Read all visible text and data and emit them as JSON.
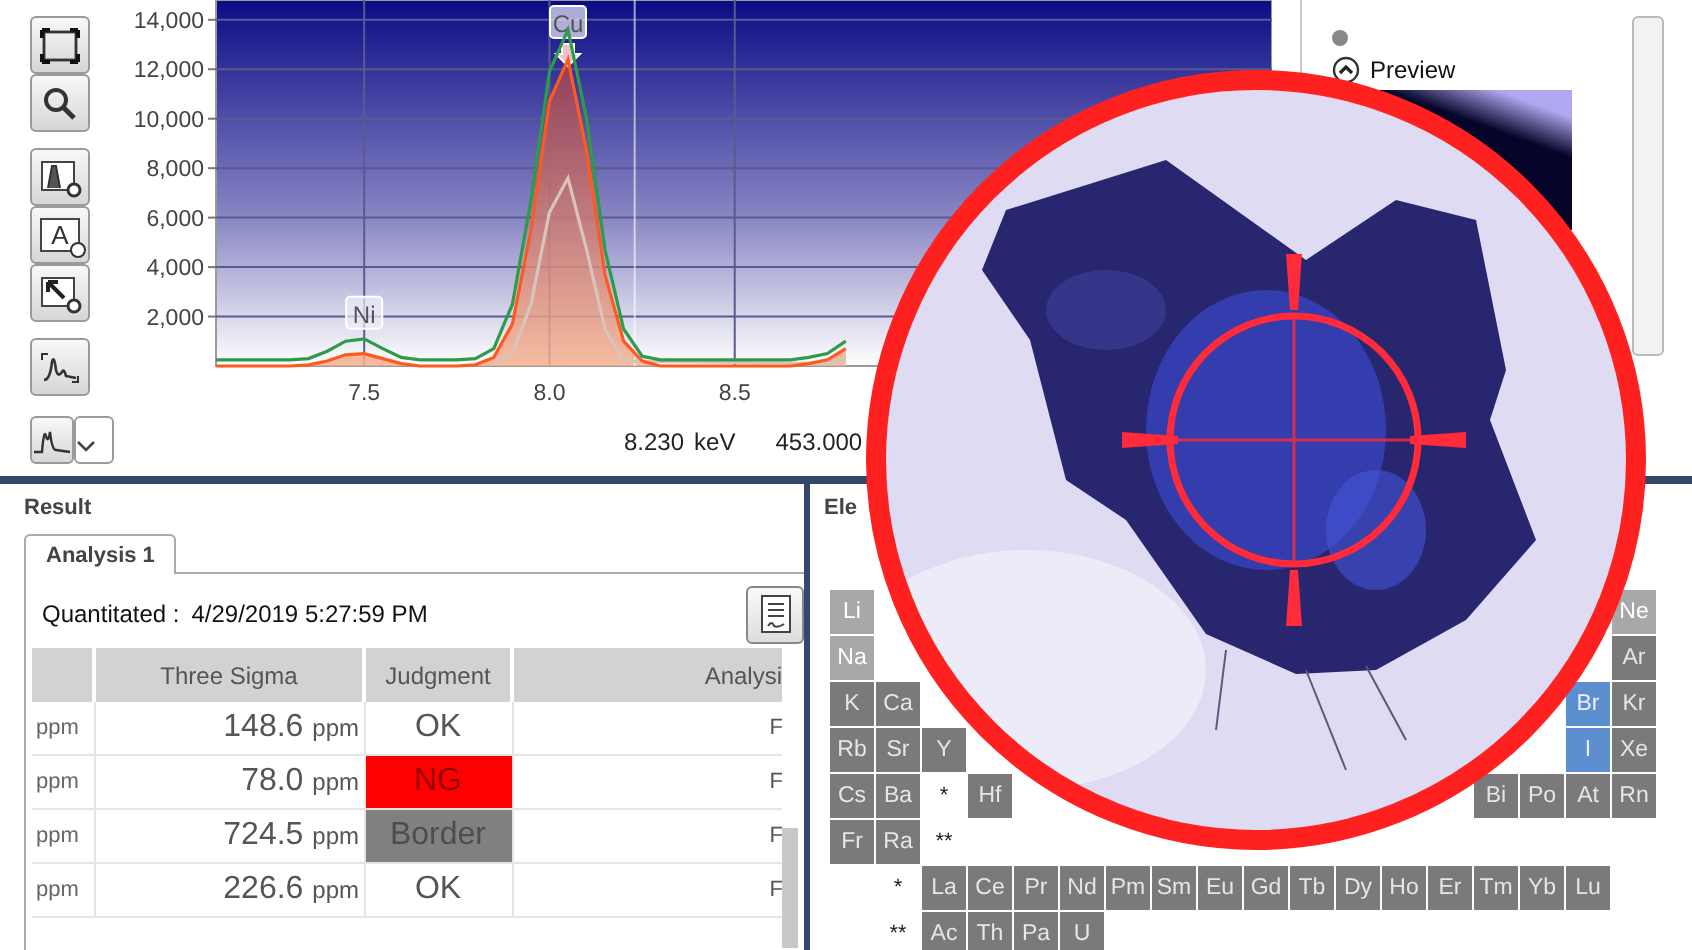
{
  "toolbar": [
    [
      {
        "kind": "fit"
      },
      {
        "kind": "zoom"
      }
    ],
    [
      {
        "kind": "peak"
      },
      {
        "kind": "label",
        "glyph": "A"
      },
      {
        "kind": "pointer"
      }
    ],
    [
      {
        "kind": "spectrum"
      }
    ]
  ],
  "spectrum": {
    "chart_data": {
      "type": "line",
      "xlim": [
        7.1,
        9.95
      ],
      "ylim": [
        0,
        14800
      ],
      "grid": true,
      "xticks": [
        {
          "value": 7.5,
          "label": "7.5"
        },
        {
          "value": 8.0,
          "label": "8.0"
        },
        {
          "value": 8.5,
          "label": "8.5"
        }
      ],
      "yticks": [
        {
          "value": 2000,
          "label": "2,000"
        },
        {
          "value": 4000,
          "label": "4,000"
        },
        {
          "value": 6000,
          "label": "6,000"
        },
        {
          "value": 8000,
          "label": "8,000"
        },
        {
          "value": 10000,
          "label": "10,000"
        },
        {
          "value": 12000,
          "label": "12,000"
        },
        {
          "value": 14000,
          "label": "14,000"
        }
      ],
      "x": [
        7.1,
        7.15,
        7.2,
        7.25,
        7.3,
        7.35,
        7.4,
        7.45,
        7.5,
        7.55,
        7.6,
        7.65,
        7.7,
        7.75,
        7.8,
        7.85,
        7.9,
        7.95,
        8.0,
        8.05,
        8.1,
        8.15,
        8.2,
        8.25,
        8.3,
        8.35,
        8.4,
        8.45,
        8.5,
        8.55,
        8.6,
        8.65,
        8.7,
        8.75,
        8.8
      ],
      "series": [
        {
          "color": "#2e9a4a",
          "values": [
            250,
            250,
            250,
            250,
            250,
            300,
            600,
            1000,
            1100,
            700,
            350,
            250,
            250,
            250,
            300,
            700,
            2500,
            6700,
            11900,
            13600,
            10000,
            4700,
            1500,
            400,
            250,
            250,
            250,
            250,
            250,
            250,
            250,
            250,
            350,
            500,
            1000
          ]
        },
        {
          "color": "#ff5a1e",
          "values": [
            0,
            0,
            0,
            0,
            0,
            50,
            200,
            450,
            500,
            300,
            100,
            0,
            0,
            0,
            50,
            350,
            1700,
            5500,
            10700,
            12400,
            8700,
            3700,
            1000,
            200,
            0,
            0,
            0,
            0,
            0,
            0,
            0,
            0,
            100,
            250,
            700
          ]
        },
        {
          "color": "#d8c4bc",
          "values": [
            null,
            null,
            null,
            null,
            null,
            null,
            null,
            null,
            null,
            null,
            null,
            null,
            null,
            null,
            null,
            100,
            500,
            2500,
            6200,
            7600,
            4700,
            1500,
            200,
            null,
            null,
            null,
            null,
            null,
            null,
            null,
            null,
            null,
            null,
            100,
            300
          ]
        }
      ],
      "annotations": [
        {
          "x": 7.5,
          "y": 1100,
          "text": "Ni"
        },
        {
          "x": 8.05,
          "y": 13600,
          "text": "Cu"
        }
      ],
      "ref_lines": [
        {
          "axis": "x",
          "value": 8.23
        }
      ]
    },
    "cursor": {
      "energy": "8.230",
      "unit": "keV",
      "count": "453.000"
    }
  },
  "preview": {
    "label": "Preview",
    "expanded": true
  },
  "result": {
    "title": "Result",
    "tabs": [
      {
        "label": "Analysis 1",
        "selected": true
      }
    ],
    "quantitated_label": "Quantitated :",
    "quantitated_time": "4/29/2019 5:27:59 PM",
    "table": {
      "columns": [
        "Three Sigma",
        "Judgment",
        "Analysi"
      ],
      "rows": [
        {
          "unit": "ppm",
          "three_sigma": "148.6",
          "sigma_unit": "ppm",
          "judgment": "OK",
          "color": "#ffffff",
          "analysis": "F"
        },
        {
          "unit": "ppm",
          "three_sigma": "78.0",
          "sigma_unit": "ppm",
          "judgment": "NG",
          "color": "#ff0000",
          "analysis": "F"
        },
        {
          "unit": "ppm",
          "three_sigma": "724.5",
          "sigma_unit": "ppm",
          "judgment": "Border",
          "color": "#808080",
          "analysis": "F"
        },
        {
          "unit": "ppm",
          "three_sigma": "226.6",
          "sigma_unit": "ppm",
          "judgment": "OK",
          "color": "#ffffff",
          "analysis": "F"
        }
      ]
    }
  },
  "elements": {
    "title": "Ele",
    "rows": [
      {
        "left": [
          {
            "kind": "element",
            "label": "Li",
            "selected": false,
            "disabled": true
          }
        ],
        "right": [
          {
            "kind": "element",
            "label": "Ne",
            "selected": false,
            "disabled": true
          }
        ]
      },
      {
        "left": [
          {
            "kind": "element",
            "label": "Na",
            "selected": false,
            "disabled": true
          }
        ],
        "right": [
          {
            "kind": "element",
            "label": "Ar",
            "selected": false,
            "disabled": false
          }
        ]
      },
      {
        "left": [
          {
            "kind": "element",
            "label": "K",
            "selected": false,
            "disabled": false
          },
          {
            "kind": "element",
            "label": "Ca",
            "selected": false,
            "disabled": false
          }
        ],
        "right": [
          {
            "kind": "element",
            "label": "Br",
            "selected": true,
            "disabled": false
          },
          {
            "kind": "element",
            "label": "Kr",
            "selected": false,
            "disabled": false
          }
        ]
      },
      {
        "left": [
          {
            "kind": "element",
            "label": "Rb",
            "selected": false,
            "disabled": false
          },
          {
            "kind": "element",
            "label": "Sr",
            "selected": false,
            "disabled": false
          },
          {
            "kind": "element",
            "label": "Y",
            "selected": false,
            "disabled": false
          }
        ],
        "right": [
          {
            "kind": "element",
            "label": "I",
            "selected": true,
            "disabled": false
          },
          {
            "kind": "element",
            "label": "Xe",
            "selected": false,
            "disabled": false
          }
        ]
      },
      {
        "left": [
          {
            "kind": "element",
            "label": "Cs",
            "selected": false,
            "disabled": false
          },
          {
            "kind": "element",
            "label": "Ba",
            "selected": false,
            "disabled": false
          },
          {
            "kind": "mark",
            "label": "*"
          },
          {
            "kind": "element",
            "label": "Hf",
            "selected": false,
            "disabled": false
          }
        ],
        "right": [
          {
            "kind": "element",
            "label": "Bi",
            "selected": false,
            "disabled": false
          },
          {
            "kind": "element",
            "label": "Po",
            "selected": false,
            "disabled": false
          },
          {
            "kind": "element",
            "label": "At",
            "selected": false,
            "disabled": false
          },
          {
            "kind": "element",
            "label": "Rn",
            "selected": false,
            "disabled": false
          }
        ]
      },
      {
        "left": [
          {
            "kind": "element",
            "label": "Fr",
            "selected": false,
            "disabled": false
          },
          {
            "kind": "element",
            "label": "Ra",
            "selected": false,
            "disabled": false
          },
          {
            "kind": "mark",
            "label": "**"
          }
        ],
        "right": []
      },
      {
        "left": [
          {
            "kind": "gap"
          },
          {
            "kind": "mark",
            "label": "*"
          },
          {
            "kind": "element",
            "label": "La",
            "selected": false,
            "disabled": false
          },
          {
            "kind": "element",
            "label": "Ce",
            "selected": false,
            "disabled": false
          },
          {
            "kind": "element",
            "label": "Pr",
            "selected": false,
            "disabled": false
          },
          {
            "kind": "element",
            "label": "Nd",
            "selected": false,
            "disabled": false
          },
          {
            "kind": "element",
            "label": "Pm",
            "selected": false,
            "disabled": false
          },
          {
            "kind": "element",
            "label": "Sm",
            "selected": false,
            "disabled": false
          },
          {
            "kind": "element",
            "label": "Eu",
            "selected": false,
            "disabled": false
          },
          {
            "kind": "element",
            "label": "Gd",
            "selected": false,
            "disabled": false
          },
          {
            "kind": "element",
            "label": "Tb",
            "selected": false,
            "disabled": false
          },
          {
            "kind": "element",
            "label": "Dy",
            "selected": false,
            "disabled": false
          },
          {
            "kind": "element",
            "label": "Ho",
            "selected": false,
            "disabled": false
          },
          {
            "kind": "element",
            "label": "Er",
            "selected": false,
            "disabled": false
          },
          {
            "kind": "element",
            "label": "Tm",
            "selected": false,
            "disabled": false
          },
          {
            "kind": "element",
            "label": "Yb",
            "selected": false,
            "disabled": false
          },
          {
            "kind": "element",
            "label": "Lu",
            "selected": false,
            "disabled": false
          }
        ],
        "right": []
      },
      {
        "left": [
          {
            "kind": "gap"
          },
          {
            "kind": "mark",
            "label": "**"
          },
          {
            "kind": "element",
            "label": "Ac",
            "selected": false,
            "disabled": false
          },
          {
            "kind": "element",
            "label": "Th",
            "selected": false,
            "disabled": false
          },
          {
            "kind": "element",
            "label": "Pa",
            "selected": false,
            "disabled": false
          },
          {
            "kind": "element",
            "label": "U",
            "selected": false,
            "disabled": false
          }
        ],
        "right": []
      }
    ]
  }
}
